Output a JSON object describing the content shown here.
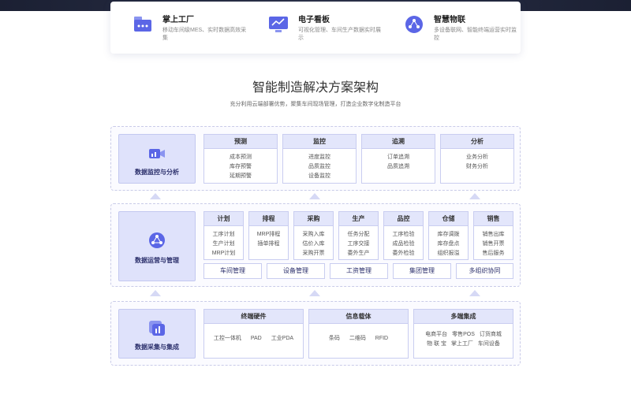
{
  "features": [
    {
      "title": "掌上工厂",
      "desc": "移动车间级MES、实时数据高效采集"
    },
    {
      "title": "电子看板",
      "desc": "可视化管理、车间生产数据实时展示"
    },
    {
      "title": "智慧物联",
      "desc": "多设备联网、智能终端运营实时监控"
    }
  ],
  "heading": "智能制造解决方案架构",
  "subheading": "充分利用云端部署优势，聚集车间现场管理，打造企业数字化制造平台",
  "layer1": {
    "label": "数据监控与分析",
    "columns": [
      {
        "title": "预测",
        "items": [
          "成本预测",
          "库存预警",
          "延期预警"
        ]
      },
      {
        "title": "监控",
        "items": [
          "进度监控",
          "品质监控",
          "设备监控"
        ]
      },
      {
        "title": "追溯",
        "items": [
          "订单追溯",
          "品质追溯"
        ]
      },
      {
        "title": "分析",
        "items": [
          "业务分析",
          "财务分析"
        ]
      }
    ]
  },
  "layer2": {
    "label": "数据运营与管理",
    "columns": [
      {
        "title": "计划",
        "items": [
          "工序计划",
          "生产计划",
          "MRP计划"
        ]
      },
      {
        "title": "排程",
        "items": [
          "MRP排程",
          "插单排程"
        ]
      },
      {
        "title": "采购",
        "items": [
          "采购入库",
          "估价入库",
          "采购开票"
        ]
      },
      {
        "title": "生产",
        "items": [
          "任务分配",
          "工序交接",
          "委外生产"
        ]
      },
      {
        "title": "品控",
        "items": [
          "工序检验",
          "成品检验",
          "委外检验"
        ]
      },
      {
        "title": "仓储",
        "items": [
          "库存调拨",
          "库存盘点",
          "组织报溢"
        ]
      },
      {
        "title": "销售",
        "items": [
          "销售出库",
          "销售开票",
          "售后服务"
        ]
      }
    ],
    "pills": [
      "车间管理",
      "设备管理",
      "工资管理",
      "集团管理",
      "多组织协同"
    ]
  },
  "layer3": {
    "label": "数据采集与集成",
    "columns": [
      {
        "title": "终端硬件",
        "rows": [
          [
            "工控一体机",
            "PAD",
            "工业PDA"
          ]
        ]
      },
      {
        "title": "信息载体",
        "rows": [
          [
            "条码",
            "二维码",
            "RFID"
          ]
        ]
      },
      {
        "title": "多端集成",
        "rows": [
          [
            "电商平台",
            "零售POS",
            "订货商城"
          ],
          [
            "物 联 宝",
            "掌上工厂",
            "车间设备"
          ]
        ]
      }
    ]
  },
  "colors": {
    "accent": "#3f4bd8",
    "header_bg": "#e3e6fb",
    "side_bg": "#dfe2fb",
    "border": "#c9cdf0"
  },
  "icons": {
    "feature": [
      "factory-icon",
      "monitor-chart-icon",
      "iot-network-icon"
    ],
    "sides": [
      "video-monitor-icon",
      "network-hub-icon",
      "collect-chart-icon"
    ]
  }
}
